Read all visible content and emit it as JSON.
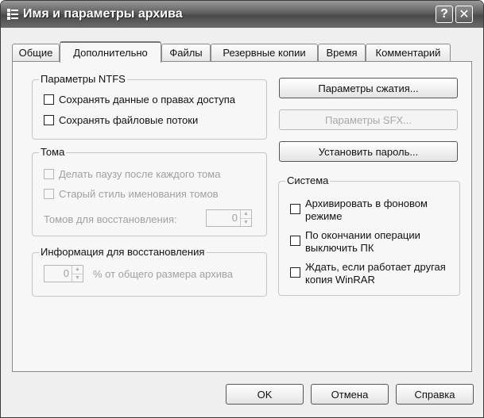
{
  "window": {
    "title": "Имя и параметры архива",
    "help_button": "?",
    "close_button": "✕"
  },
  "tabs": [
    {
      "label": "Общие"
    },
    {
      "label": "Дополнительно",
      "active": true
    },
    {
      "label": "Файлы"
    },
    {
      "label": "Резервные копии"
    },
    {
      "label": "Время"
    },
    {
      "label": "Комментарий"
    }
  ],
  "ntfs": {
    "title": "Параметры NTFS",
    "save_access": "Сохранять данные о правах доступа",
    "save_streams": "Сохранять файловые потоки"
  },
  "volumes": {
    "title": "Тома",
    "pause": "Делать паузу после каждого тома",
    "old_style": "Старый стиль именования томов",
    "recovery_label": "Томов для восстановления:",
    "recovery_value": "0"
  },
  "recovery": {
    "title": "Информация для восстановления",
    "value": "0",
    "suffix": "% от общего размера архива"
  },
  "buttons": {
    "compression": "Параметры сжатия...",
    "sfx": "Параметры SFX...",
    "password": "Установить пароль..."
  },
  "system": {
    "title": "Система",
    "background": "Архивировать в фоновом режиме",
    "shutdown": "По окончании операции выключить ПК",
    "wait": "Ждать, если работает другая копия WinRAR"
  },
  "footer": {
    "ok": "OK",
    "cancel": "Отмена",
    "help": "Справка"
  }
}
